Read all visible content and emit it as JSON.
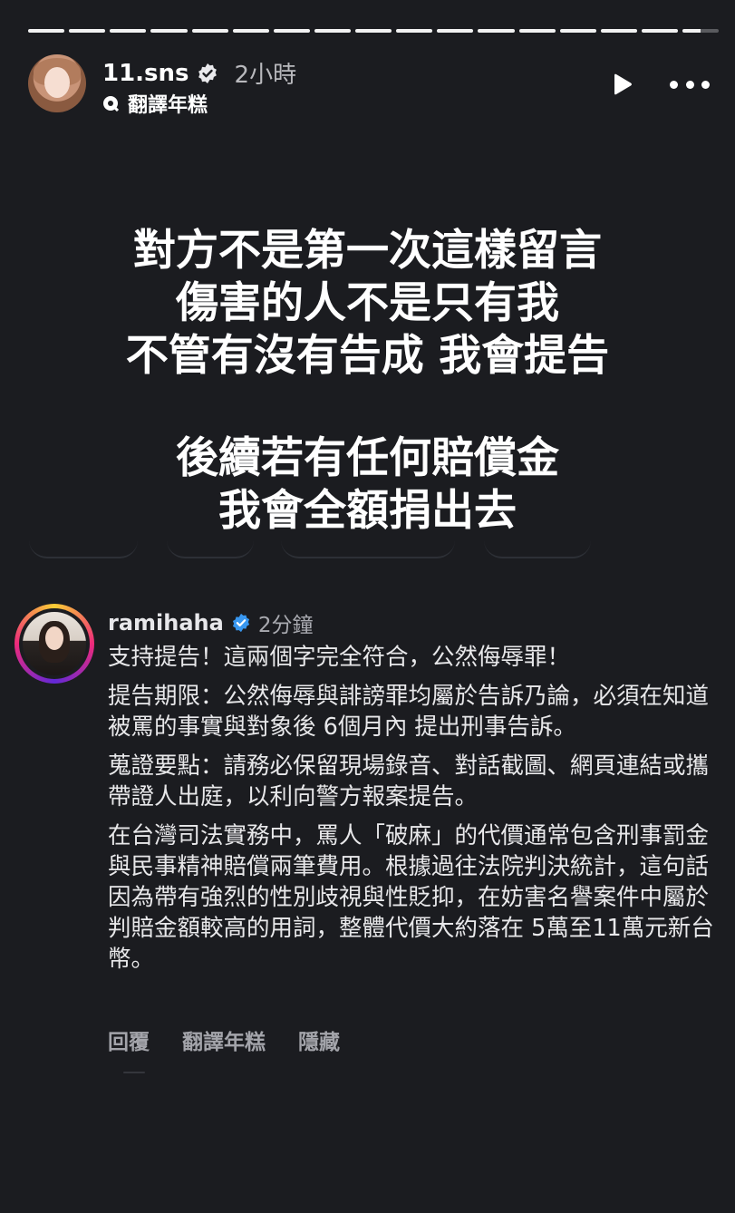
{
  "progress": {
    "total_segments": 17,
    "current_fraction": 0.97
  },
  "header": {
    "username": "11.sns",
    "time": "2小時",
    "translate_label": "翻譯年糕"
  },
  "overlay": {
    "block1": [
      "對方不是第一次這樣留言",
      "傷害的人不是只有我",
      "不管有沒有告成 我會提告"
    ],
    "block2": [
      "後續若有任何賠償金",
      "我會全額捐出去"
    ]
  },
  "comment": {
    "username": "ramihaha",
    "time": "2分鐘",
    "paragraphs": [
      "支持提告！這兩個字完全符合，公然侮辱罪！",
      "提告期限：公然侮辱與誹謗罪均屬於告訴乃論，必須在知道被罵的事實與對象後 6個月內 提出刑事告訴。",
      "蒐證要點：請務必保留現場錄音、對話截圖、網頁連結或攜帶證人出庭，以利向警方報案提告。",
      "在台灣司法實務中，罵人「破麻」的代價通常包含刑事罰金與民事精神賠償兩筆費用。根據過往法院判決統計，這句話因為帶有強烈的性別歧視與性貶抑，在妨害名譽案件中屬於判賠金額較高的用詞，整體代價大約落在 5萬至11萬元新台幣。"
    ],
    "actions": {
      "reply": "回覆",
      "translate": "翻譯年糕",
      "hide": "隱藏"
    }
  },
  "colors": {
    "background": "#1b1c20",
    "verified": "#3897f0",
    "muted": "#a9aab0"
  },
  "icons": [
    "verified-badge-icon",
    "translate-bubble-icon",
    "play-icon",
    "more-icon"
  ]
}
